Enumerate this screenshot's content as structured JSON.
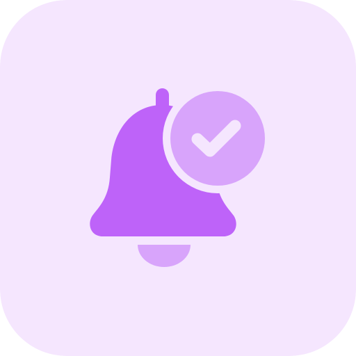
{
  "icon": {
    "name": "notification-bell-check-icon",
    "colors": {
      "tile_background": "#F5E6FE",
      "bell_body": "#BE63F9",
      "bell_clapper": "#D8A4FB",
      "check_badge": "#D8A4FB",
      "check_mark": "#F5E6FE"
    }
  }
}
